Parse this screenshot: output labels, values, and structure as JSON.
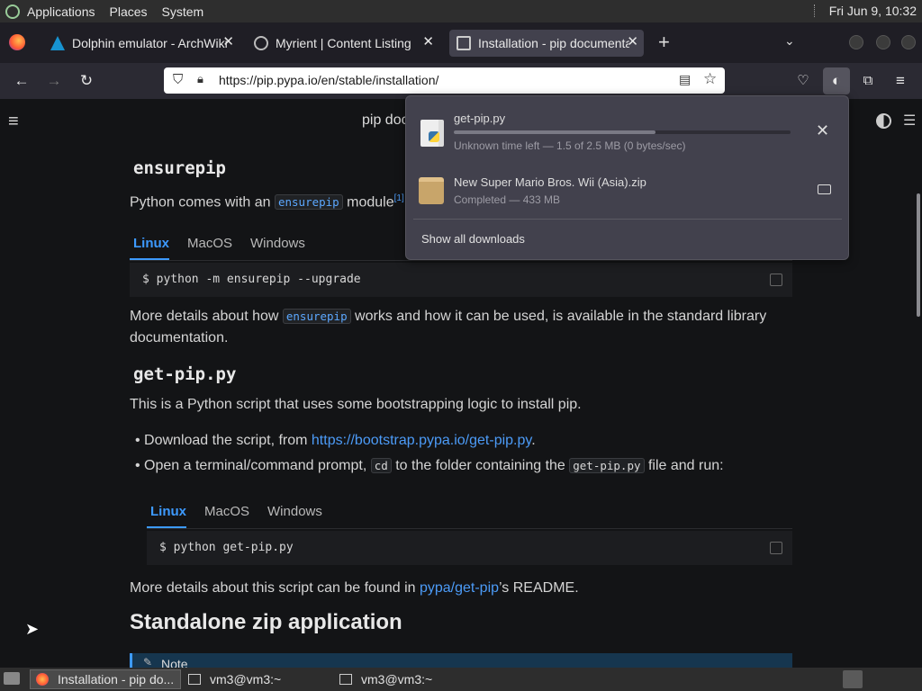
{
  "topbar": {
    "menus": [
      "Applications",
      "Places",
      "System"
    ],
    "clock": "Fri Jun  9, 10:32"
  },
  "tabs": [
    {
      "title": "Dolphin emulator - ArchWiki",
      "active": false
    },
    {
      "title": "Myrient | Content Listing",
      "active": false
    },
    {
      "title": "Installation - pip documenta",
      "active": true
    }
  ],
  "urlbar": {
    "url": "https://pip.pypa.io/en/stable/installation/"
  },
  "page": {
    "header_title": "pip doc",
    "ensurepip": {
      "heading": "ensurepip",
      "intro_before": "Python comes with an ",
      "intro_code": "ensurepip",
      "intro_after": " module",
      "footnote": "[1]",
      "tabs": [
        "Linux",
        "MacOS",
        "Windows"
      ],
      "command": "$ python -m ensurepip --upgrade",
      "details_before": "More details about how ",
      "details_code": "ensurepip",
      "details_after_line1": " works and how it can be used, is available in the standard library",
      "details_line2": "documentation."
    },
    "getpip": {
      "heading": "get-pip.py",
      "intro": "This is a Python script that uses some bootstrapping logic to install pip.",
      "bullet1_before": "Download the script, from ",
      "bullet1_link": "https://bootstrap.pypa.io/get-pip.py",
      "bullet1_after": ".",
      "bullet2_before": "Open a terminal/command prompt, ",
      "bullet2_code1": "cd",
      "bullet2_mid": " to the folder containing the ",
      "bullet2_code2": "get-pip.py",
      "bullet2_after": " file and run:",
      "tabs": [
        "Linux",
        "MacOS",
        "Windows"
      ],
      "command": "$ python get-pip.py",
      "readme_before": "More details about this script can be found in ",
      "readme_link": "pypa/get-pip",
      "readme_after": "’s README."
    },
    "zipapp": {
      "heading": "Standalone zip application",
      "note": "Note"
    }
  },
  "downloads": {
    "items": [
      {
        "name": "get-pip.py",
        "status": "Unknown time left — 1.5 of 2.5 MB (0 bytes/sec)",
        "progress": 0.6
      },
      {
        "name": "New Super Mario Bros. Wii (Asia).zip",
        "status": "Completed — 433 MB"
      }
    ],
    "show_all": "Show all downloads"
  },
  "taskbar": {
    "items": [
      "Installation - pip do...",
      "vm3@vm3:~",
      "vm3@vm3:~"
    ]
  },
  "colors": {
    "accent": "#3d9aff",
    "link": "#4c9bf7",
    "panel": "#42414d"
  }
}
